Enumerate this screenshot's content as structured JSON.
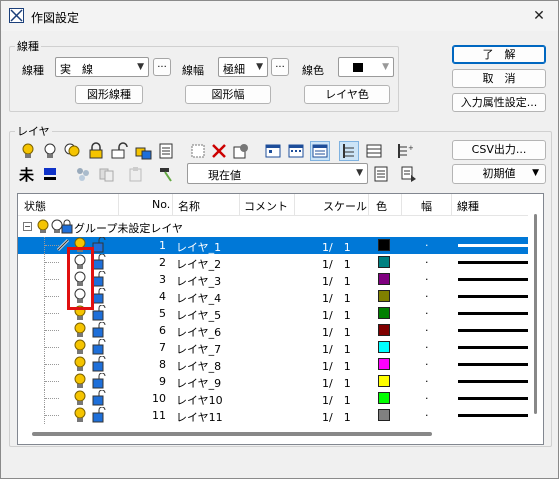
{
  "title": "作図設定",
  "line_type_group": {
    "legend": "線種",
    "line_type_label": "線種",
    "line_type_value": "実　線",
    "more": "...",
    "width_label": "線幅",
    "width_value": "極細",
    "color_label": "線色",
    "button_figure_line_type": "図形線種",
    "button_figure_width": "図形幅",
    "button_layer_color": "レイヤ色"
  },
  "buttons": {
    "ok": "了　解",
    "cancel": "取　消",
    "input_attr": "入力属性設定..."
  },
  "layer_group": {
    "legend": "レイヤ",
    "csv_output": "CSV出力...",
    "initial_value": "初期値",
    "current_value": "現在値"
  },
  "grid": {
    "columns": [
      "状態",
      "No.",
      "名称",
      "コメント",
      "スケール",
      "色",
      "幅",
      "線種"
    ],
    "group_row": "グループ未設定レイヤ",
    "rows": [
      {
        "no": "1",
        "name": "レイヤ_1",
        "scale": "1/　1",
        "color": "#000000",
        "width": "·",
        "selected": true,
        "bulb": "on"
      },
      {
        "no": "2",
        "name": "レイヤ_2",
        "scale": "1/　1",
        "color": "#008080",
        "width": "·",
        "selected": false,
        "bulb": "off"
      },
      {
        "no": "3",
        "name": "レイヤ_3",
        "scale": "1/　1",
        "color": "#800080",
        "width": "·",
        "selected": false,
        "bulb": "off"
      },
      {
        "no": "4",
        "name": "レイヤ_4",
        "scale": "1/　1",
        "color": "#808000",
        "width": "·",
        "selected": false,
        "bulb": "off"
      },
      {
        "no": "5",
        "name": "レイヤ_5",
        "scale": "1/　1",
        "color": "#008000",
        "width": "·",
        "selected": false,
        "bulb": "on"
      },
      {
        "no": "6",
        "name": "レイヤ_6",
        "scale": "1/　1",
        "color": "#800000",
        "width": "·",
        "selected": false,
        "bulb": "on"
      },
      {
        "no": "7",
        "name": "レイヤ_7",
        "scale": "1/　1",
        "color": "#00ffff",
        "width": "·",
        "selected": false,
        "bulb": "on"
      },
      {
        "no": "8",
        "name": "レイヤ_8",
        "scale": "1/　1",
        "color": "#ff00ff",
        "width": "·",
        "selected": false,
        "bulb": "on"
      },
      {
        "no": "9",
        "name": "レイヤ_9",
        "scale": "1/　1",
        "color": "#ffff00",
        "width": "·",
        "selected": false,
        "bulb": "on"
      },
      {
        "no": "10",
        "name": "レイヤ10",
        "scale": "1/　1",
        "color": "#00ff00",
        "width": "·",
        "selected": false,
        "bulb": "on"
      },
      {
        "no": "11",
        "name": "レイヤ11",
        "scale": "1/　1",
        "color": "#808080",
        "width": "·",
        "selected": false,
        "bulb": "on"
      }
    ]
  },
  "colors": {
    "selection": "#0078d7",
    "highlight_box": "#e01010",
    "bulb_on": "#f5c400"
  }
}
